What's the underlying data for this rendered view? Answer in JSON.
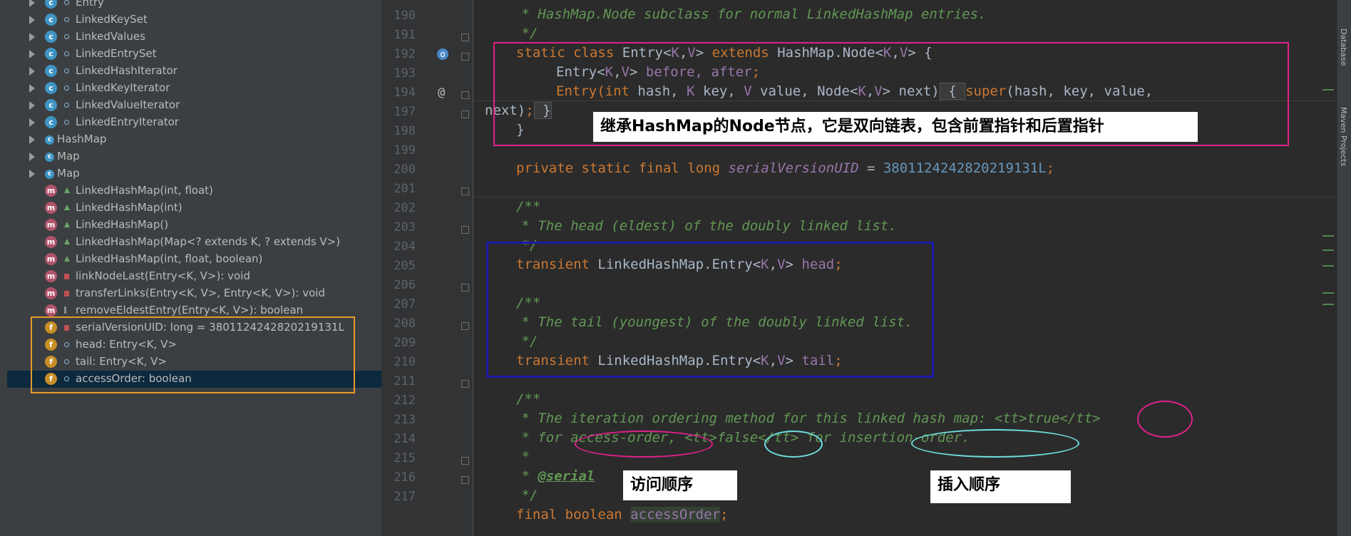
{
  "structure": {
    "rows": [
      {
        "label": "Entry",
        "icon": "class",
        "vis": "pub",
        "arrow": true,
        "indent": 1
      },
      {
        "label": "LinkedKeySet",
        "icon": "class",
        "vis": "pub",
        "arrow": true,
        "indent": 1
      },
      {
        "label": "LinkedValues",
        "icon": "class",
        "vis": "pub",
        "arrow": true,
        "indent": 1
      },
      {
        "label": "LinkedEntrySet",
        "icon": "class",
        "vis": "pub",
        "arrow": true,
        "indent": 1
      },
      {
        "label": "LinkedHashIterator",
        "icon": "class",
        "vis": "pub",
        "arrow": true,
        "indent": 1
      },
      {
        "label": "LinkedKeyIterator",
        "icon": "class",
        "vis": "pub",
        "arrow": true,
        "indent": 1
      },
      {
        "label": "LinkedValueIterator",
        "icon": "class",
        "vis": "pub",
        "arrow": true,
        "indent": 1
      },
      {
        "label": "LinkedEntryIterator",
        "icon": "class",
        "vis": "pub",
        "arrow": true,
        "indent": 1
      },
      {
        "label": "HashMap",
        "icon": "class",
        "vis": "none",
        "arrow": true,
        "indent": 0
      },
      {
        "label": "Map",
        "icon": "class",
        "vis": "none",
        "arrow": true,
        "indent": 0
      },
      {
        "label": "Map",
        "icon": "class",
        "vis": "none",
        "arrow": true,
        "indent": 0
      },
      {
        "label": "LinkedHashMap(int, float)",
        "icon": "method",
        "vis": "prot",
        "arrow": false,
        "indent": 1
      },
      {
        "label": "LinkedHashMap(int)",
        "icon": "method",
        "vis": "prot",
        "arrow": false,
        "indent": 1
      },
      {
        "label": "LinkedHashMap()",
        "icon": "method",
        "vis": "prot",
        "arrow": false,
        "indent": 1
      },
      {
        "label": "LinkedHashMap(Map<? extends K, ? extends V>)",
        "icon": "method",
        "vis": "prot",
        "arrow": false,
        "indent": 1
      },
      {
        "label": "LinkedHashMap(int, float, boolean)",
        "icon": "method",
        "vis": "prot",
        "arrow": false,
        "indent": 1
      },
      {
        "label": "linkNodeLast(Entry<K, V>): void",
        "icon": "method",
        "vis": "priv",
        "arrow": false,
        "indent": 1
      },
      {
        "label": "transferLinks(Entry<K, V>, Entry<K, V>): void",
        "icon": "method",
        "vis": "priv",
        "arrow": false,
        "indent": 1
      },
      {
        "label": "removeEldestEntry(Entry<K, V>): boolean",
        "icon": "method",
        "vis": "pkg",
        "arrow": false,
        "indent": 1
      },
      {
        "label": "serialVersionUID: long = 3801124242820219131L",
        "icon": "field",
        "vis": "priv",
        "arrow": false,
        "indent": 1
      },
      {
        "label": "head: Entry<K, V>",
        "icon": "field",
        "vis": "pub",
        "arrow": false,
        "indent": 1
      },
      {
        "label": "tail: Entry<K, V>",
        "icon": "field",
        "vis": "pub",
        "arrow": false,
        "indent": 1
      },
      {
        "label": "accessOrder: boolean",
        "icon": "field",
        "vis": "pub",
        "arrow": false,
        "indent": 1,
        "selected": true
      }
    ]
  },
  "editor": {
    "line_numbers": [
      "190",
      "191",
      "192",
      "193",
      "194",
      "197",
      "198",
      "199",
      "200",
      "201",
      "202",
      "203",
      "204",
      "205",
      "206",
      "207",
      "208",
      "209",
      "210",
      "211",
      "212",
      "213",
      "214",
      "215",
      "216",
      "217"
    ],
    "gutter_icons": {
      "l192": "override-marker-icon",
      "l194": "@"
    },
    "tokens": {
      "comment_close": "*/",
      "comment_open": "/**",
      "c190": " * HashMap.Node subclass for normal LinkedHashMap entries.",
      "c191": " */",
      "static": "static",
      "class": "class",
      "Entry": "Entry<",
      "K": "K",
      "comma": ",",
      "V": "V",
      "gt": ">",
      "extends": "extends",
      "HashMapNode": "HashMap.Node<",
      "brace_open": " {",
      "entry_indent": "Entry<",
      "before_after": "before, after",
      "semicolon": ";",
      "ctor_entry": "Entry(",
      "int": "int",
      "hash": " hash, ",
      "key": " key, ",
      "value": " value, Node<",
      "next": "> next)",
      "fold_open": " { ",
      "super": "super",
      "super_args": "(hash, key, value,",
      "next2": "next)",
      "fold_close": " }",
      "brace_close": "}",
      "private": "private",
      "final": "final",
      "long": "long",
      "serialVersionUID": "serialVersionUID",
      "equals": " = ",
      "uid_value": "3801124242820219131L",
      "c202": " * The head (eldest) of the doubly linked list.",
      "transient": "transient",
      "LHMEntry": " LinkedHashMap.Entry<",
      "head": "head",
      "c207": " * The tail (youngest) of the doubly linked list.",
      "tail": "tail",
      "c212": " * The iteration ordering method for this linked hash map: <tt>true</tt>",
      "c213": " * for access-order, <tt>false</tt> for insertion-order.",
      "c214": " *",
      "c215a": " * ",
      "serial_tag": "@serial",
      "boolean": "boolean",
      "accessOrder": "accessOrder"
    }
  },
  "annotations": {
    "note_node": "继承HashMap的Node节点，它是双向链表，包含前置指针和后置指针",
    "note_access": "访问顺序",
    "note_insert": "插入顺序",
    "colors": {
      "magenta": "#e0218a",
      "navy": "#1a1aa8",
      "orange": "#e59a2c",
      "cyan": "#6fe0e0"
    }
  },
  "rightbar": {
    "tabs": [
      "Database",
      "Maven Projects"
    ]
  }
}
